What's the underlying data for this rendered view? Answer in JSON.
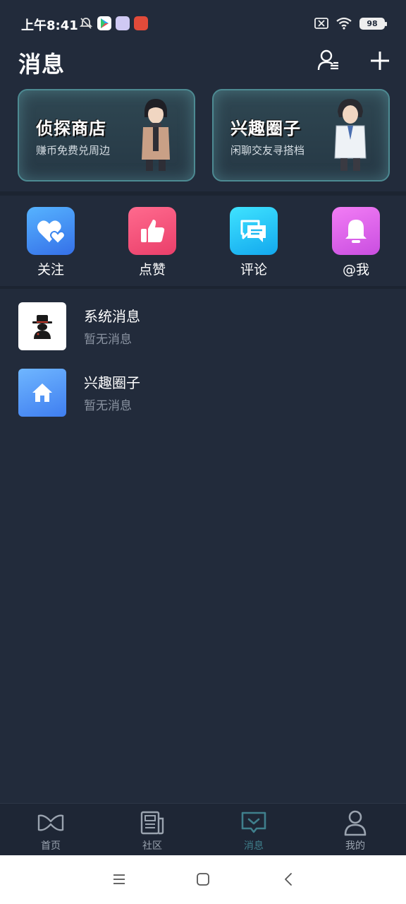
{
  "status_bar": {
    "time": "上午8:41",
    "battery": "98"
  },
  "header": {
    "title": "消息"
  },
  "banners": [
    {
      "title": "侦探商店",
      "subtitle": "赚币免费兑周边"
    },
    {
      "title": "兴趣圈子",
      "subtitle": "闲聊交友寻搭档"
    }
  ],
  "quick_actions": [
    {
      "label": "关注",
      "icon": "heart-icon",
      "color": "#3b86f0"
    },
    {
      "label": "点赞",
      "icon": "thumbs-up-icon",
      "color": "#f0507a"
    },
    {
      "label": "评论",
      "icon": "comment-icon",
      "color": "#20b8f0"
    },
    {
      "label": "@我",
      "icon": "bell-icon",
      "color": "#d85ee6"
    }
  ],
  "messages": [
    {
      "title": "系统消息",
      "subtitle": "暂无消息",
      "icon": "detective-icon"
    },
    {
      "title": "兴趣圈子",
      "subtitle": "暂无消息",
      "icon": "home-icon"
    }
  ],
  "tabs": [
    {
      "label": "首页",
      "icon": "mask-icon",
      "active": false
    },
    {
      "label": "社区",
      "icon": "newspaper-icon",
      "active": false
    },
    {
      "label": "消息",
      "icon": "message-icon",
      "active": true
    },
    {
      "label": "我的",
      "icon": "person-icon",
      "active": false
    }
  ],
  "colors": {
    "background": "#222b3b",
    "accent": "#3f7f8c",
    "banner_border": "#4d8a92"
  }
}
